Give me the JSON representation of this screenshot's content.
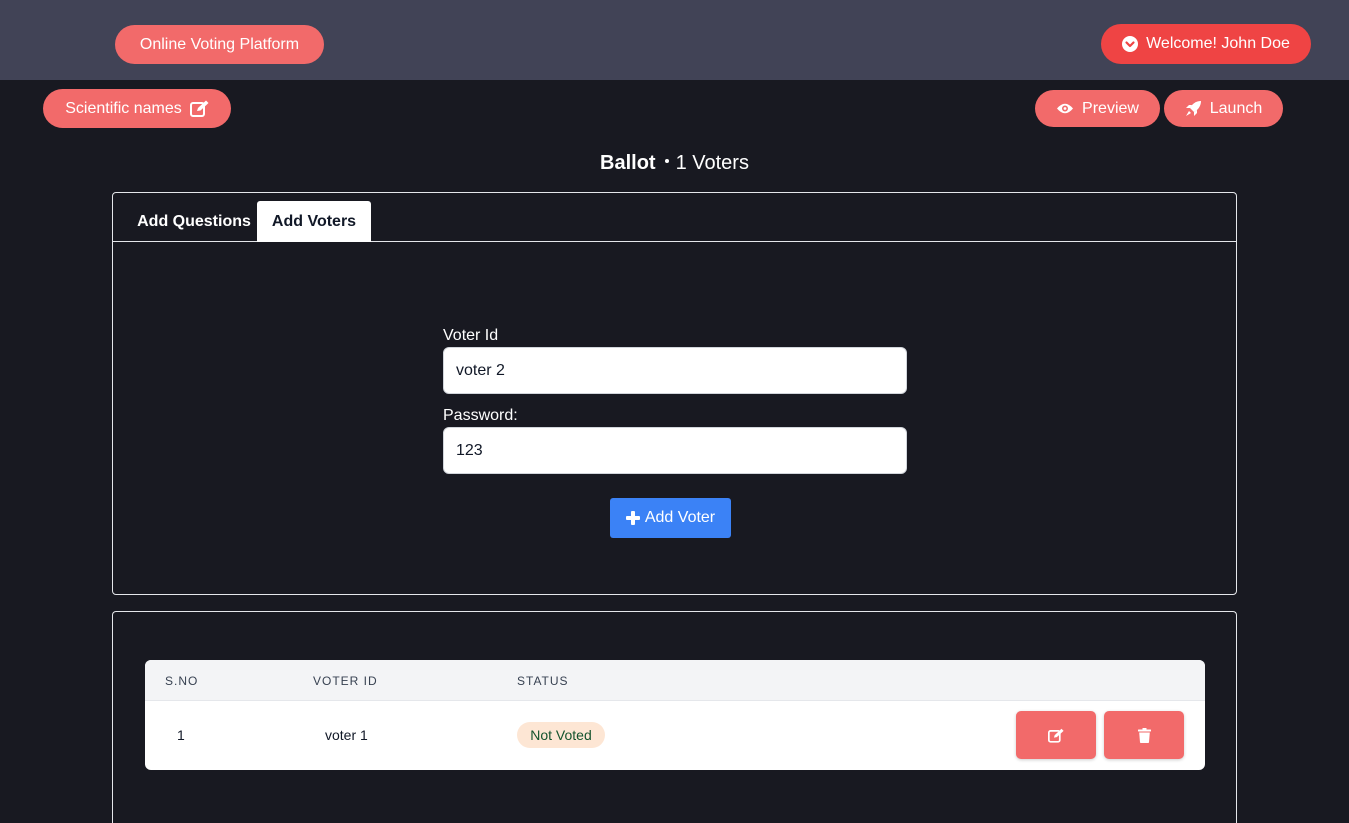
{
  "header": {
    "brand": "Online Voting Platform",
    "welcome": "Welcome! John Doe"
  },
  "toolbar": {
    "election_name": "Scientific names",
    "preview_label": "Preview",
    "launch_label": "Launch"
  },
  "page": {
    "title": "Ballot",
    "voter_count": "1 Voters"
  },
  "tabs": [
    {
      "label": "Add Questions",
      "active": false
    },
    {
      "label": "Add Voters",
      "active": true
    }
  ],
  "form": {
    "voter_id_label": "Voter Id",
    "voter_id_value": "voter 2",
    "password_label": "Password:",
    "password_value": "123",
    "add_button_label": "Add Voter"
  },
  "table": {
    "columns": [
      "S.NO",
      "VOTER ID",
      "STATUS"
    ],
    "rows": [
      {
        "sno": "1",
        "voter_id": "voter 1",
        "status": "Not Voted"
      }
    ]
  },
  "colors": {
    "accent": "#f26a6a",
    "welcome": "#ef4444",
    "primary": "#3b82f6",
    "topbar": "#414356",
    "background": "#181921"
  },
  "icons": [
    "check-circle-icon",
    "edit-icon",
    "eye-icon",
    "rocket-icon",
    "plus-icon",
    "trash-icon"
  ]
}
